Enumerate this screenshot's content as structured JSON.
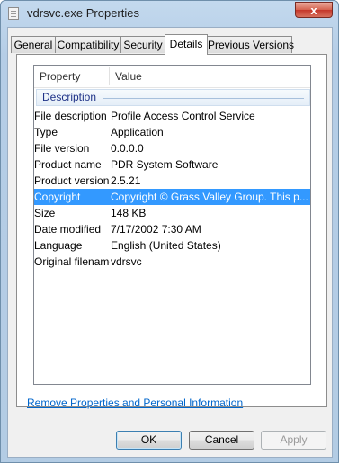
{
  "window": {
    "title": "vdrsvc.exe Properties",
    "close_label": "x"
  },
  "tabs": [
    {
      "label": "General",
      "active": false
    },
    {
      "label": "Compatibility",
      "active": false
    },
    {
      "label": "Security",
      "active": false
    },
    {
      "label": "Details",
      "active": true
    },
    {
      "label": "Previous Versions",
      "active": false
    }
  ],
  "details": {
    "columns": {
      "property": "Property",
      "value": "Value"
    },
    "group_label": "Description",
    "rows": [
      {
        "name": "File description",
        "value": "Profile Access Control Service",
        "selected": false
      },
      {
        "name": "Type",
        "value": "Application",
        "selected": false
      },
      {
        "name": "File version",
        "value": "0.0.0.0",
        "selected": false
      },
      {
        "name": "Product name",
        "value": "PDR System Software",
        "selected": false
      },
      {
        "name": "Product version",
        "value": "2.5.21",
        "selected": false
      },
      {
        "name": "Copyright",
        "value": "Copyright © Grass Valley Group.   This p...",
        "selected": true
      },
      {
        "name": "Size",
        "value": "148 KB",
        "selected": false
      },
      {
        "name": "Date modified",
        "value": "7/17/2002 7:30 AM",
        "selected": false
      },
      {
        "name": "Language",
        "value": "English (United States)",
        "selected": false
      },
      {
        "name": "Original filename",
        "value": "vdrsvc",
        "selected": false
      }
    ]
  },
  "remove_link": "Remove Properties and Personal Information",
  "buttons": {
    "ok": "OK",
    "cancel": "Cancel",
    "apply": "Apply"
  },
  "colors": {
    "selection": "#3399ff",
    "link": "#0066cc",
    "group_text": "#1e3287"
  }
}
